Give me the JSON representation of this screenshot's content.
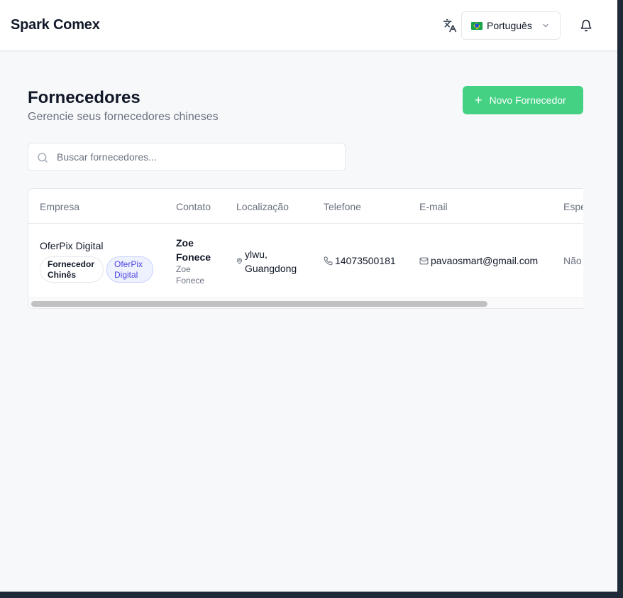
{
  "header": {
    "brand": "Spark Comex",
    "language": {
      "flag": "🇧🇷",
      "selected": "Português"
    }
  },
  "page": {
    "title": "Fornecedores",
    "subtitle": "Gerencie seus fornecedores chineses",
    "add_button": "Novo Fornecedor"
  },
  "search": {
    "placeholder": "Buscar fornecedores...",
    "value": ""
  },
  "table": {
    "columns": [
      "Empresa",
      "Contato",
      "Localização",
      "Telefone",
      "E-mail",
      "Espe"
    ],
    "rows": [
      {
        "company": "OferPix Digital",
        "badges": [
          "Fornecedor Chinês",
          "OferPix Digital"
        ],
        "contact_name": "Zoe Fonece",
        "contact_sub": "Zoe Fonece",
        "location": "ylwu, Guangdong",
        "phone": "14073500181",
        "email": "pavaosmart@gmail.com",
        "specialty": "Não"
      }
    ]
  },
  "colors": {
    "accent": "#44d184",
    "badge_blue": "#4f46e5"
  },
  "icons": [
    "translate-icon",
    "chevron-down-icon",
    "bell-icon",
    "plus-icon",
    "search-icon",
    "map-pin-icon",
    "phone-icon",
    "mail-icon"
  ]
}
